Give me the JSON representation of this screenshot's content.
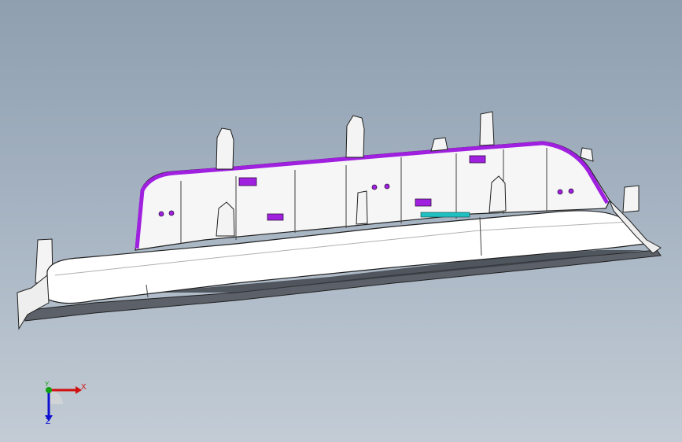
{
  "viewport": {
    "name": "3D model view",
    "background_top": "#8f9fb0",
    "background_bottom": "#c3ccd5"
  },
  "model": {
    "body_color": "#ffffff",
    "edge_color": "#202020",
    "highlight_color": "#a020e0",
    "accent_color": "#20c0c0",
    "shadow_color": "#505560"
  },
  "triad": {
    "x_label": "X",
    "y_label": "Y",
    "z_label": "Z",
    "x_color": "#d01010",
    "y_color": "#10a010",
    "z_color": "#1010d0"
  }
}
